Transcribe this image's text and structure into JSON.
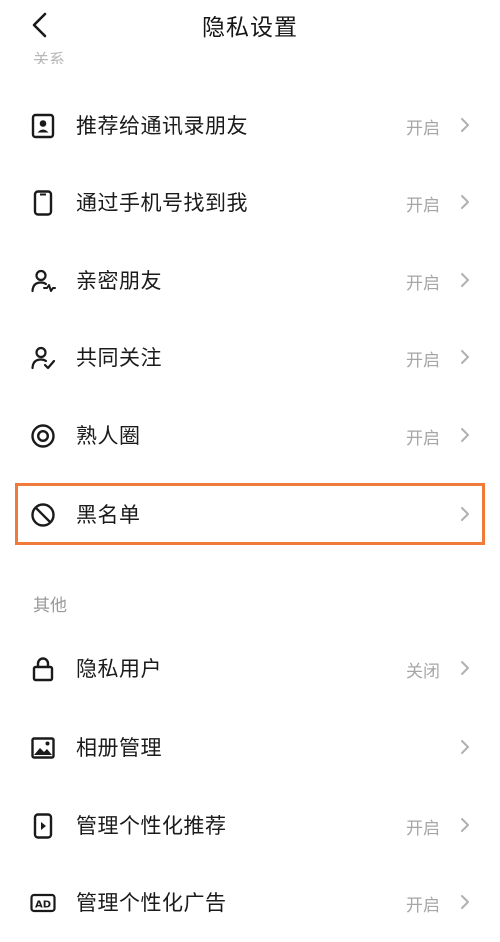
{
  "header": {
    "title": "隐私设置"
  },
  "sections": {
    "relation_cut": "关系",
    "other": "其他"
  },
  "rows": [
    {
      "name": "recommend-contacts",
      "label": "推荐给通讯录朋友",
      "value": "开启",
      "icon": "contact-card-icon"
    },
    {
      "name": "find-by-phone",
      "label": "通过手机号找到我",
      "value": "开启",
      "icon": "phone-icon"
    },
    {
      "name": "close-friends",
      "label": "亲密朋友",
      "value": "开启",
      "icon": "person-heart-icon"
    },
    {
      "name": "mutual-follow",
      "label": "共同关注",
      "value": "开启",
      "icon": "person-check-icon"
    },
    {
      "name": "acquaintance-circle",
      "label": "熟人圈",
      "value": "开启",
      "icon": "circle-target-icon"
    },
    {
      "name": "blacklist",
      "label": "黑名单",
      "value": "",
      "icon": "block-icon"
    },
    {
      "name": "private-user",
      "label": "隐私用户",
      "value": "关闭",
      "icon": "lock-icon"
    },
    {
      "name": "album-manage",
      "label": "相册管理",
      "value": "",
      "icon": "image-icon"
    },
    {
      "name": "personalized-recommend",
      "label": "管理个性化推荐",
      "value": "开启",
      "icon": "phone-play-icon"
    },
    {
      "name": "personalized-ads",
      "label": "管理个性化广告",
      "value": "开启",
      "icon": "ad-icon"
    }
  ],
  "colors": {
    "highlight": "#f07a3a",
    "secondary_text": "#a6a6a6"
  }
}
